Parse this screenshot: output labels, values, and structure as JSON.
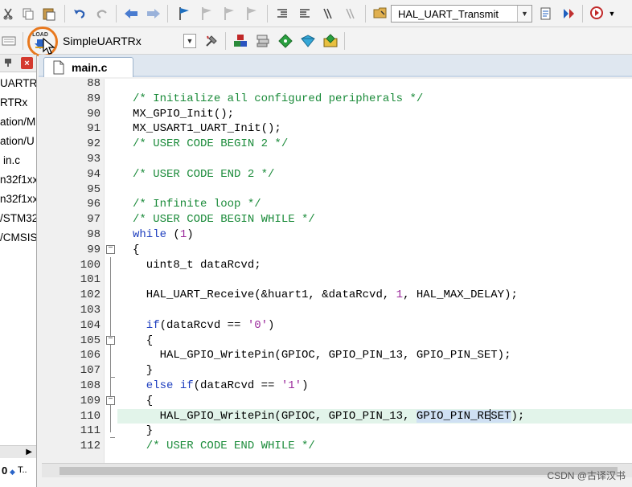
{
  "toolbar1": {
    "function_combo": "HAL_UART_Transmit"
  },
  "toolbar2": {
    "load_button_label": "LOAD",
    "target_combo": "SimpleUARTRx"
  },
  "project_panel": {
    "items": [
      "UARTR:",
      "RTRx",
      "ation/M",
      "ation/U",
      "in.c",
      "n32f1xx",
      "n32f1xx",
      "/STM32",
      "/CMSIS"
    ],
    "bottom_tabs": [
      "0",
      "T.."
    ]
  },
  "editor": {
    "tab_label": "main.c",
    "lines": [
      {
        "n": "88",
        "fold": ""
      },
      {
        "n": "89",
        "fold": ""
      },
      {
        "n": "90",
        "fold": ""
      },
      {
        "n": "91",
        "fold": ""
      },
      {
        "n": "92",
        "fold": ""
      },
      {
        "n": "93",
        "fold": ""
      },
      {
        "n": "94",
        "fold": ""
      },
      {
        "n": "95",
        "fold": ""
      },
      {
        "n": "96",
        "fold": ""
      },
      {
        "n": "97",
        "fold": ""
      },
      {
        "n": "98",
        "fold": ""
      },
      {
        "n": "99",
        "fold": "open"
      },
      {
        "n": "100",
        "fold": ""
      },
      {
        "n": "101",
        "fold": ""
      },
      {
        "n": "102",
        "fold": ""
      },
      {
        "n": "103",
        "fold": ""
      },
      {
        "n": "104",
        "fold": ""
      },
      {
        "n": "105",
        "fold": "open"
      },
      {
        "n": "106",
        "fold": ""
      },
      {
        "n": "107",
        "fold": "end"
      },
      {
        "n": "108",
        "fold": ""
      },
      {
        "n": "109",
        "fold": "open"
      },
      {
        "n": "110",
        "fold": ""
      },
      {
        "n": "111",
        "fold": "end"
      },
      {
        "n": "112",
        "fold": ""
      }
    ],
    "code": {
      "l89": "/* Initialize all configured peripherals */",
      "l90": "MX_GPIO_Init();",
      "l91": "MX_USART1_UART_Init();",
      "l92": "/* USER CODE BEGIN 2 */",
      "l94": "/* USER CODE END 2 */",
      "l96": "/* Infinite loop */",
      "l97": "/* USER CODE BEGIN WHILE */",
      "l98_kw": "while",
      "l98_a": " (",
      "l98_num": "1",
      "l98_b": ")",
      "l99": "{",
      "l100": "  uint8_t dataRcvd;",
      "l102_a": "  HAL_UART_Receive(&huart1, &dataRcvd, ",
      "l102_num": "1",
      "l102_b": ", HAL_MAX_DELAY);",
      "l104_kw": "  if",
      "l104_a": "(dataRcvd == ",
      "l104_str": "'0'",
      "l104_b": ")",
      "l105": "  {",
      "l106": "    HAL_GPIO_WritePin(GPIOC, GPIO_PIN_13, GPIO_PIN_SET);",
      "l107": "  }",
      "l108_kw1": "  else",
      "l108_sp": " ",
      "l108_kw2": "if",
      "l108_a": "(dataRcvd == ",
      "l108_str": "'1'",
      "l108_b": ")",
      "l109": "  {",
      "l110_a": "    HAL_GPIO_WritePin(GPIOC, GPIO_PIN_13, ",
      "l110_sel1": "GPIO_PIN_RE",
      "l110_sel2": "SET",
      "l110_b": ");",
      "l111": "  }",
      "l112": "  /* USER CODE END WHILE */"
    }
  },
  "watermark": "CSDN @古译汉书",
  "colors": {
    "comment": "#1b8b3a",
    "keyword": "#1f3fbf",
    "number": "#9b2a9b",
    "current_line": "#e2f4ea",
    "selection": "#cfe0f3",
    "highlight_ring": "#e8781e"
  }
}
